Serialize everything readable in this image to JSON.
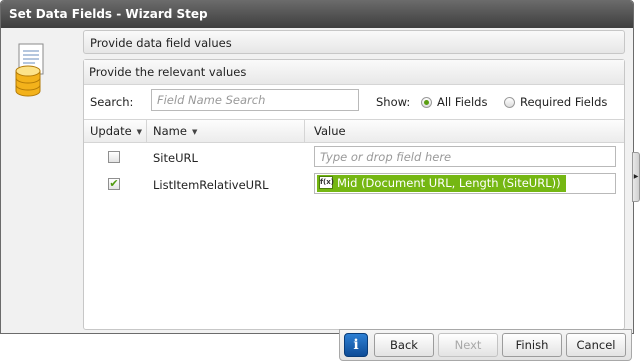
{
  "window": {
    "title": "Set Data Fields - Wizard Step"
  },
  "sections": {
    "provide_values_header": "Provide data field values",
    "relevant_values_title": "Provide the relevant values"
  },
  "search": {
    "label": "Search:",
    "placeholder": "Field Name Search"
  },
  "show": {
    "label": "Show:",
    "options": [
      {
        "label": "All Fields",
        "selected": true
      },
      {
        "label": "Required Fields",
        "selected": false
      }
    ]
  },
  "grid": {
    "columns": {
      "update": "Update",
      "name": "Name",
      "value": "Value"
    },
    "rows": [
      {
        "checked": false,
        "name": "SiteURL",
        "value": "",
        "value_placeholder": "Type or drop field here"
      },
      {
        "checked": true,
        "name": "ListItemRelativeURL",
        "value": "Mid (Document URL, Length (SiteURL))",
        "value_placeholder": ""
      }
    ]
  },
  "footer": {
    "info_label": "i",
    "back_label": "Back",
    "next_label": "Next",
    "finish_label": "Finish",
    "cancel_label": "Cancel"
  },
  "colors": {
    "accent_green": "#75b713",
    "title_bar": "#4a4a4a",
    "info_blue": "#1565c0"
  },
  "icons": {
    "wizard": "document-database-icon",
    "check": "checkmark-icon",
    "function": "function-icon"
  }
}
